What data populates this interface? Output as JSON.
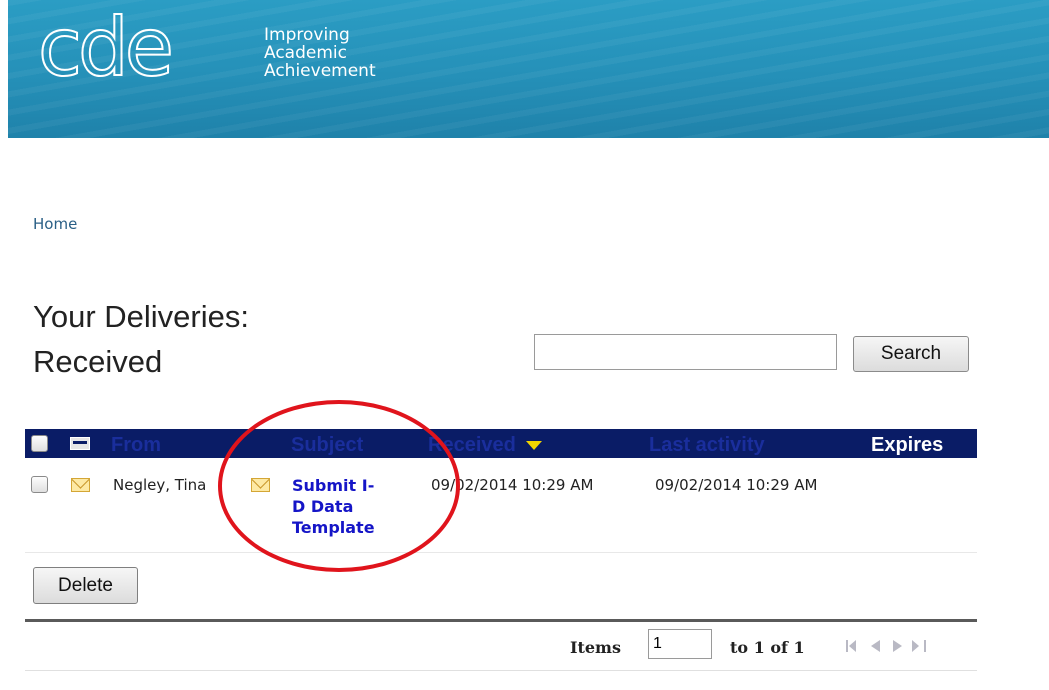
{
  "banner": {
    "logo_text": "cde",
    "tagline": [
      "Improving",
      "Academic",
      "Achievement"
    ]
  },
  "breadcrumb": {
    "home": "Home"
  },
  "page_title": {
    "line1": "Your Deliveries:",
    "line2": "Received"
  },
  "search": {
    "value": "",
    "placeholder": "",
    "button_label": "Search"
  },
  "grid": {
    "columns": {
      "from": "From",
      "subject": "Subject",
      "received": "Received",
      "last_activity": "Last activity",
      "expires": "Expires"
    },
    "sort_column": "received",
    "rows": [
      {
        "from": "Negley, Tina",
        "subject_lines": [
          "Submit I-",
          "D Data",
          "Template"
        ],
        "received": "09/02/2014 10:29 AM",
        "last_activity": "09/02/2014 10:29 AM",
        "expires": ""
      }
    ]
  },
  "actions": {
    "delete_label": "Delete"
  },
  "pager": {
    "items_label": "Items",
    "page_value": "1",
    "range_text": "to 1 of 1"
  },
  "colors": {
    "header_bg": "#0a1c66",
    "link": "#1515c7",
    "annotation": "#e0141c",
    "banner": "#2590b8"
  }
}
